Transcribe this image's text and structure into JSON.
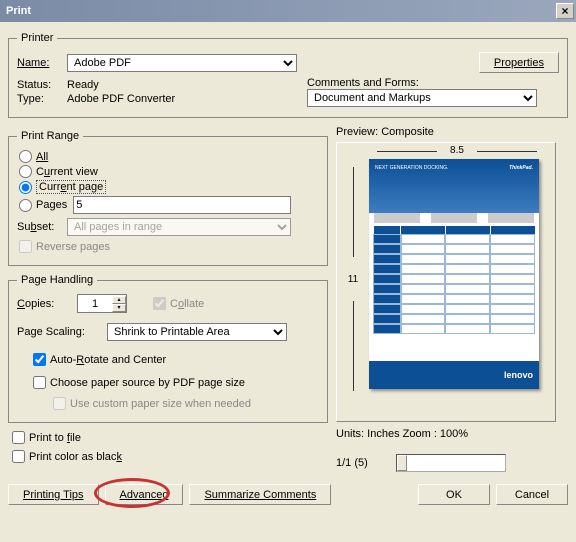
{
  "window": {
    "title": "Print",
    "close": "×"
  },
  "printer": {
    "legend": "Printer",
    "name_label": "Name:",
    "name_value": "Adobe PDF",
    "properties_btn": "Properties",
    "status_label": "Status:",
    "status_value": "Ready",
    "type_label": "Type:",
    "type_value": "Adobe PDF Converter",
    "comments_label": "Comments and Forms:",
    "comments_value": "Document and Markups"
  },
  "range": {
    "legend": "Print Range",
    "all": "All",
    "current_view": "Current view",
    "current_page": "Current page",
    "pages": "Pages",
    "pages_value": "5",
    "subset_label": "Subset:",
    "subset_value": "All pages in range",
    "reverse": "Reverse pages"
  },
  "handling": {
    "legend": "Page Handling",
    "copies_label": "Copies:",
    "copies_value": "1",
    "collate": "Collate",
    "scaling_label": "Page Scaling:",
    "scaling_value": "Shrink to Printable Area",
    "autorotate": "Auto-Rotate and Center",
    "choose_source": "Choose paper source by PDF page size",
    "use_custom": "Use custom paper size when needed"
  },
  "options": {
    "print_to_file": "Print to file",
    "print_black": "Print color as black"
  },
  "preview": {
    "label": "Preview: Composite",
    "width": "8.5",
    "height": "11",
    "doc_title": "NEXT GENERATION DOCKING.",
    "brand": "ThinkPad.",
    "footer_brand": "lenovo",
    "units": "Units: Inches Zoom : 100%",
    "page_indicator": "1/1 (5)"
  },
  "buttons": {
    "tips": "Printing Tips",
    "advanced": "Advanced",
    "summarize": "Summarize Comments",
    "ok": "OK",
    "cancel": "Cancel"
  }
}
